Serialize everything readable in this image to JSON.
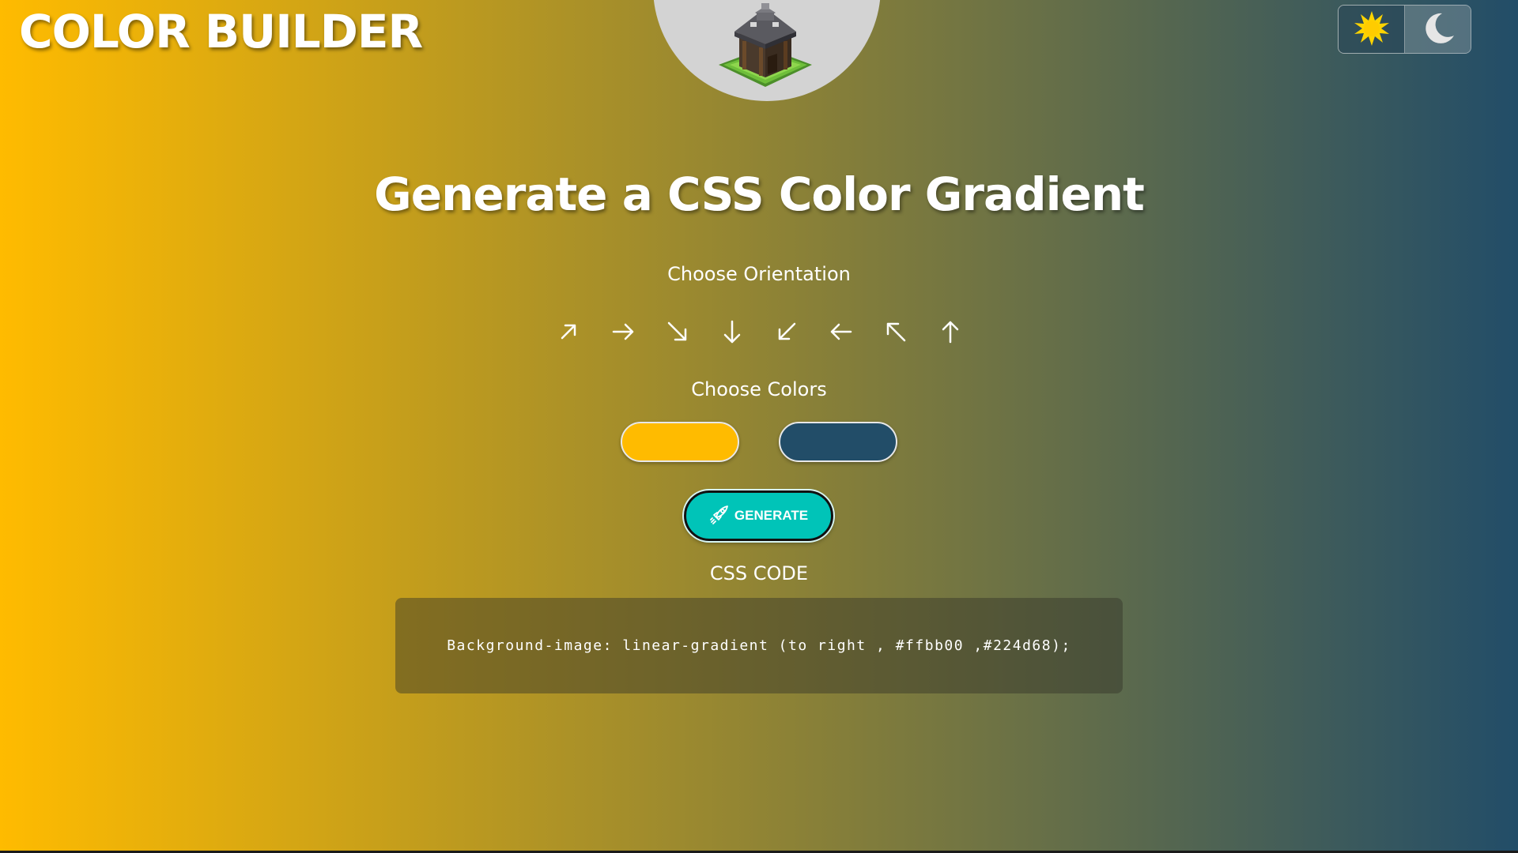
{
  "header": {
    "brand": "COLOR BUILDER",
    "logo_icon": "town-hall-building-logo",
    "theme_toggle": {
      "light_icon": "sun-icon",
      "dark_icon": "moon-icon"
    }
  },
  "main": {
    "headline": "Generate a CSS Color Gradient",
    "orientation_label": "Choose Orientation",
    "orientations": [
      {
        "icon": "arrow-up-right-icon",
        "direction": "to top right"
      },
      {
        "icon": "arrow-right-icon",
        "direction": "to right"
      },
      {
        "icon": "arrow-down-right-icon",
        "direction": "to bottom right"
      },
      {
        "icon": "arrow-down-icon",
        "direction": "to bottom"
      },
      {
        "icon": "arrow-down-left-icon",
        "direction": "to bottom left"
      },
      {
        "icon": "arrow-left-icon",
        "direction": "to left"
      },
      {
        "icon": "arrow-up-left-icon",
        "direction": "to top left"
      },
      {
        "icon": "arrow-up-icon",
        "direction": "to top"
      }
    ],
    "colors_label": "Choose Colors",
    "color_1": "#ffbb00",
    "color_2": "#224d68",
    "generate_label": "GENERATE",
    "generate_icon": "rocket-icon",
    "code_label": "CSS CODE",
    "code_text": "Background-image: linear-gradient (to right , #ffbb00 ,#224d68);"
  },
  "colors": {
    "generate_button": "#00c4b8",
    "sun": "#ffd400"
  }
}
